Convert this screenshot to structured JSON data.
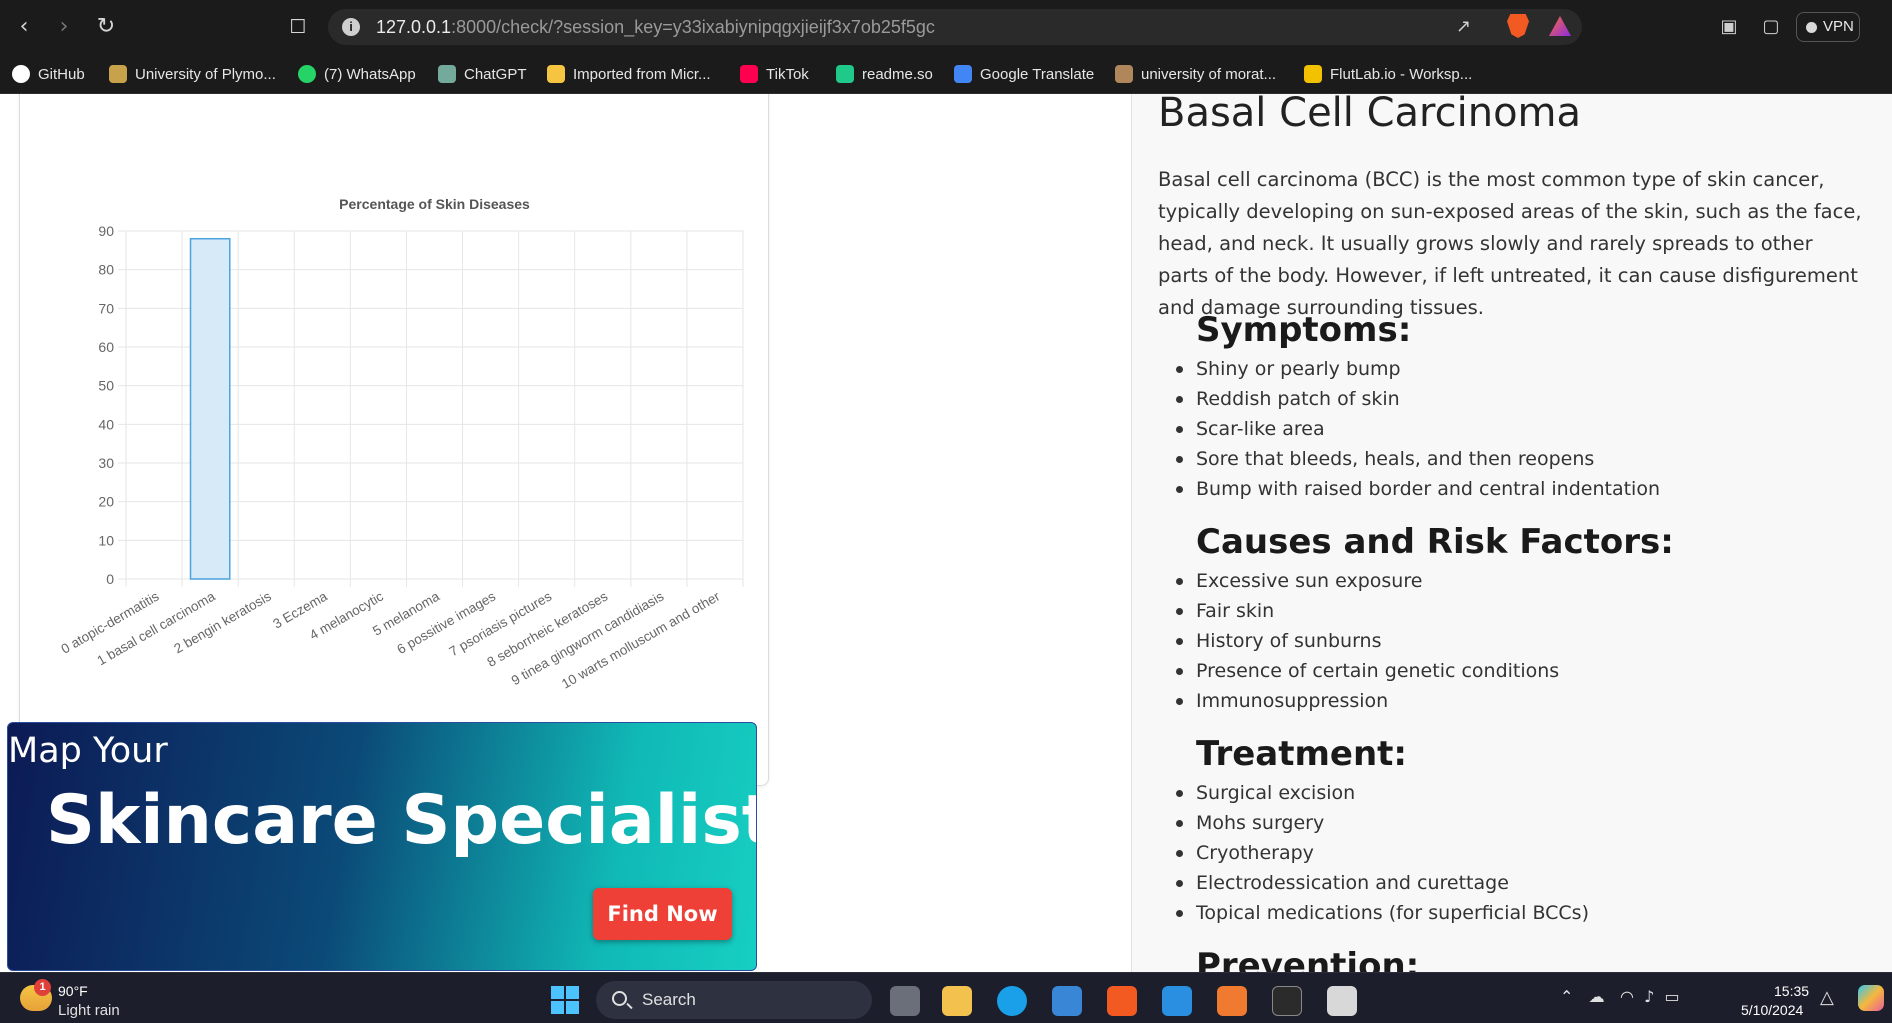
{
  "browser": {
    "url_host": "127.0.0.1",
    "url_path": ":8000/check/?session_key=y33ixabiynipqgxjieijf3x7ob25f5gc",
    "vpn_label": "VPN",
    "bookmarks": [
      {
        "label": "GitHub",
        "icon": "github-icon",
        "color": "#ffffff"
      },
      {
        "label": "University of Plymo...",
        "icon": "university-crest-icon",
        "color": "#c8a24a"
      },
      {
        "label": "(7) WhatsApp",
        "icon": "whatsapp-icon",
        "color": "#25d366"
      },
      {
        "label": "ChatGPT",
        "icon": "chatgpt-icon",
        "color": "#74aa9c"
      },
      {
        "label": "Imported from Micr...",
        "icon": "folder-icon",
        "color": "#f5c542"
      },
      {
        "label": "TikTok",
        "icon": "tiktok-icon",
        "color": "#ff0050"
      },
      {
        "label": "readme.so",
        "icon": "readme-icon",
        "color": "#1fc98a"
      },
      {
        "label": "Google Translate",
        "icon": "google-translate-icon",
        "color": "#4285f4"
      },
      {
        "label": "university of morat...",
        "icon": "university-logo-icon",
        "color": "#b0875a"
      },
      {
        "label": "FlutLab.io - Worksp...",
        "icon": "flutter-icon",
        "color": "#f2c200"
      }
    ]
  },
  "chart_data": {
    "type": "bar",
    "title": "Percentage of Skin Diseases",
    "categories": [
      "0 atopic-dermatitis",
      "1 basal cell carcinoma",
      "2 bengin keratosis",
      "3 Eczema",
      "4 melanocytic",
      "5 melanoma",
      "6 possitive images",
      "7 psoriasis pictures",
      "8 seborrheic keratoses",
      "9 tinea gingworm candidiasis",
      "10 warts molluscum and other"
    ],
    "values": [
      0,
      88,
      0,
      0,
      0,
      0,
      0,
      0,
      0,
      0,
      0
    ],
    "ylim": [
      0,
      90
    ],
    "yticks": [
      0,
      10,
      20,
      30,
      40,
      50,
      60,
      70,
      80,
      90
    ],
    "xlabel": "",
    "ylabel": "",
    "grid": true,
    "bar_fill": "#d6eaf8",
    "bar_stroke": "#4aa3df"
  },
  "banner": {
    "subtitle": "Map Your",
    "title": "Skincare Specialists",
    "button": "Find Now"
  },
  "info": {
    "title": "Basal Cell Carcinoma",
    "description": "Basal cell carcinoma (BCC) is the most common type of skin cancer, typically developing on sun-exposed areas of the skin, such as the face, head, and neck. It usually grows slowly and rarely spreads to other parts of the body. However, if left untreated, it can cause disfigurement and damage surrounding tissues.",
    "symptoms_heading": "Symptoms:",
    "symptoms": [
      "Shiny or pearly bump",
      "Reddish patch of skin",
      "Scar-like area",
      "Sore that bleeds, heals, and then reopens",
      "Bump with raised border and central indentation"
    ],
    "causes_heading": "Causes and Risk Factors:",
    "causes": [
      "Excessive sun exposure",
      "Fair skin",
      "History of sunburns",
      "Presence of certain genetic conditions",
      "Immunosuppression"
    ],
    "treatment_heading": "Treatment:",
    "treatment": [
      "Surgical excision",
      "Mohs surgery",
      "Cryotherapy",
      "Electrodessication and curettage",
      "Topical medications (for superficial BCCs)"
    ],
    "prevention_heading": "Prevention:"
  },
  "taskbar": {
    "weather_temp": "90°F",
    "weather_condition": "Light rain",
    "weather_badge": "1",
    "search_label": "Search",
    "time": "15:35",
    "date": "5/10/2024"
  }
}
